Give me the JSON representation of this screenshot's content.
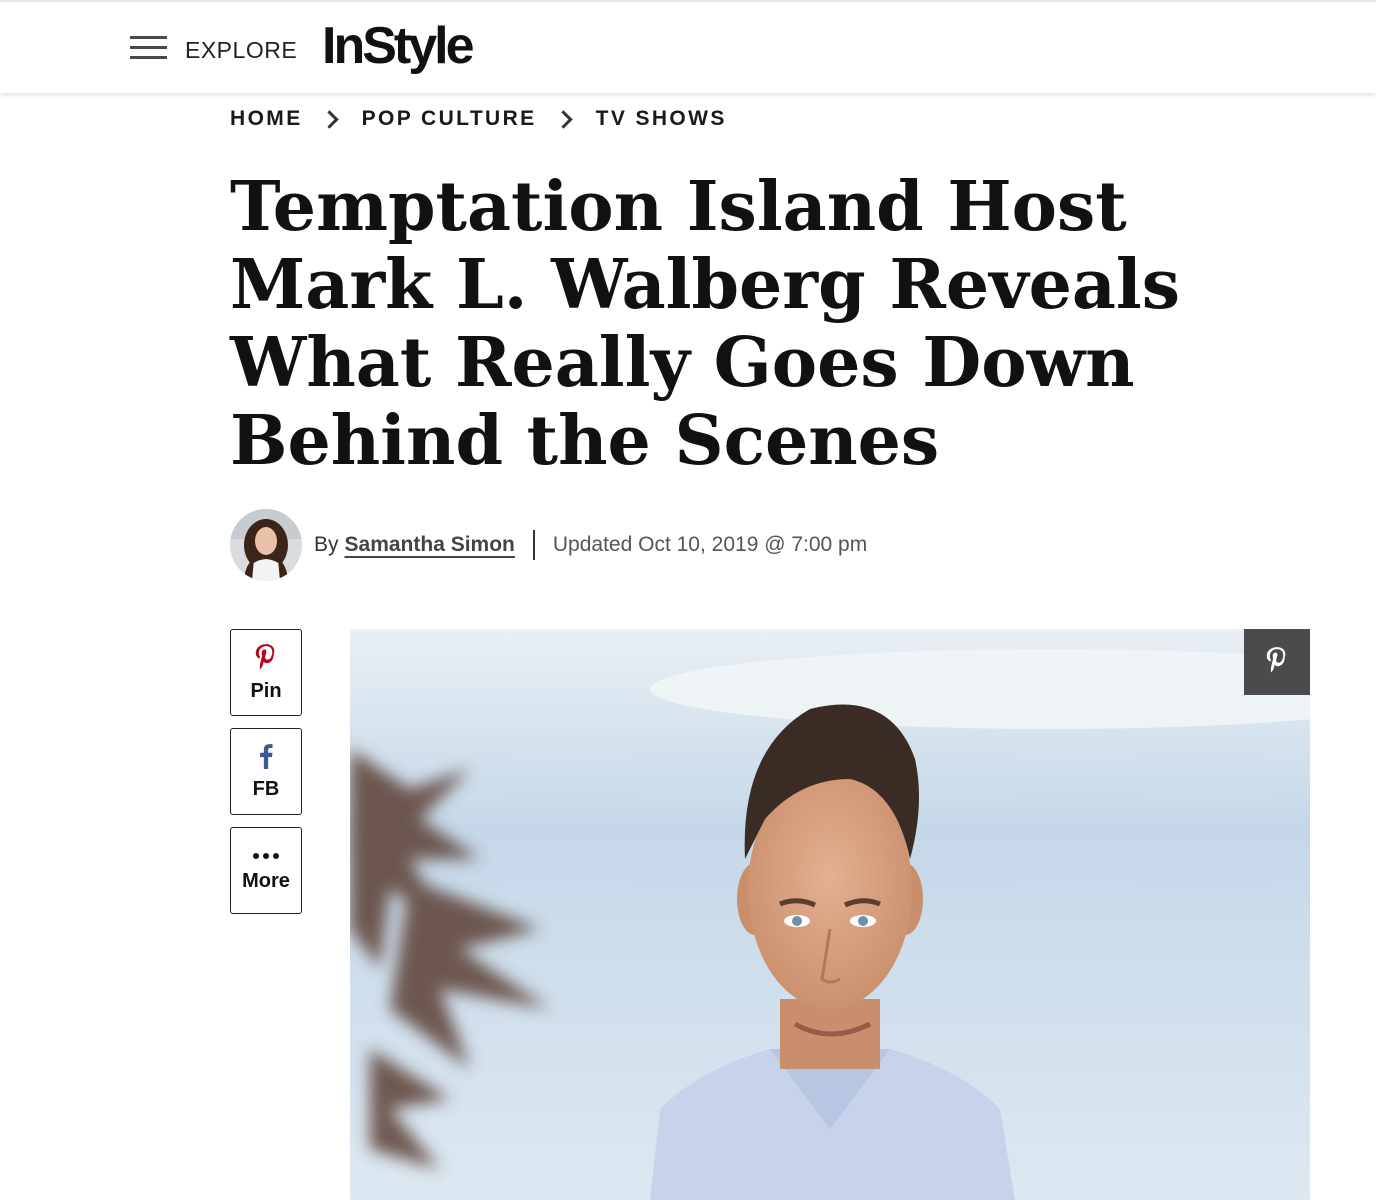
{
  "header": {
    "explore_label": "EXPLORE",
    "logo_text": "InStyle"
  },
  "breadcrumb": [
    "HOME",
    "POP CULTURE",
    "TV SHOWS"
  ],
  "article": {
    "headline": "Temptation Island Host Mark L. Walberg Reveals What Really Goes Down Behind the Scenes",
    "by_prefix": "By",
    "author": "Samantha Simon",
    "updated": "Updated Oct 10, 2019 @ 7:00 pm"
  },
  "share": {
    "pin_label": "Pin",
    "fb_label": "FB",
    "more_label": "More"
  },
  "icons": {
    "menu": "hamburger-icon",
    "pin": "pinterest-icon",
    "fb": "facebook-icon",
    "more": "ellipsis-icon",
    "image_pin": "pinterest-icon"
  },
  "colors": {
    "pinterest": "#b7081b",
    "facebook": "#3b5998",
    "pin_overlay": "#4b4b4d"
  }
}
